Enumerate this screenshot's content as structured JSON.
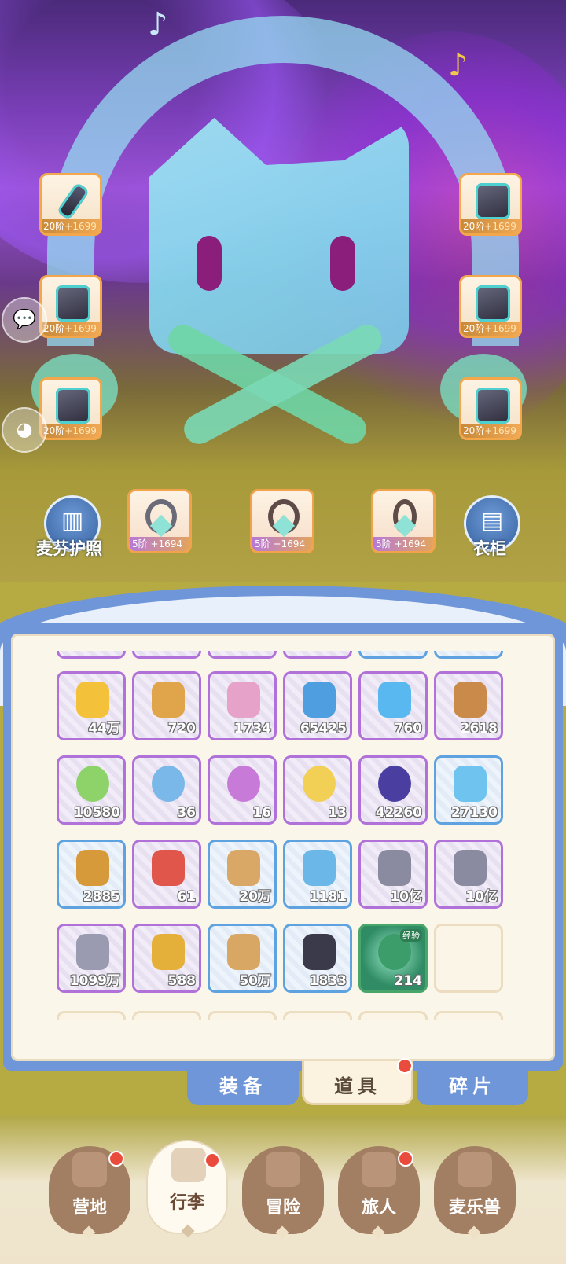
{
  "equipment": [
    {
      "name": "sword",
      "tier": "20阶",
      "plus": "+1699"
    },
    {
      "name": "helmet",
      "tier": "20阶",
      "plus": "+1699"
    },
    {
      "name": "armor",
      "tier": "20阶",
      "plus": "+1699"
    },
    {
      "name": "gloves",
      "tier": "20阶",
      "plus": "+1699"
    },
    {
      "name": "pants",
      "tier": "20阶",
      "plus": "+1699"
    },
    {
      "name": "boots",
      "tier": "20阶",
      "plus": "+1699"
    }
  ],
  "accessories": [
    {
      "name": "bracelet",
      "tier": "5阶",
      "plus": "+1694"
    },
    {
      "name": "necklace",
      "tier": "5阶",
      "plus": "+1694"
    },
    {
      "name": "pendant",
      "tier": "5阶",
      "plus": "+1694"
    }
  ],
  "passport_label": "麦芬护照",
  "wardrobe_label": "衣柜",
  "inventory": [
    {
      "count": "44万",
      "rarity": "purple",
      "icon": "gold-leaf-icon",
      "color": "#f3c23a"
    },
    {
      "count": "720",
      "rarity": "purple",
      "icon": "star-cookie-icon",
      "color": "#e0a44a"
    },
    {
      "count": "1734",
      "rarity": "purple",
      "icon": "paint-tube-icon",
      "color": "#e6a2c8"
    },
    {
      "count": "65425",
      "rarity": "purple",
      "icon": "ticket-icon",
      "color": "#4f9fe0"
    },
    {
      "count": "760",
      "rarity": "purple",
      "icon": "blue-crystal-icon",
      "color": "#5ab8f0"
    },
    {
      "count": "2618",
      "rarity": "purple",
      "icon": "book-icon",
      "color": "#c98a4a"
    },
    {
      "count": "10580",
      "rarity": "purple",
      "icon": "clover-coin-icon",
      "color": "#8ed26a"
    },
    {
      "count": "36",
      "rarity": "purple",
      "icon": "blue-flower-icon",
      "color": "#7ab8ea"
    },
    {
      "count": "16",
      "rarity": "purple",
      "icon": "purple-flower-icon",
      "color": "#c77ad8"
    },
    {
      "count": "13",
      "rarity": "purple",
      "icon": "yellow-flower-icon",
      "color": "#f2cf55"
    },
    {
      "count": "42260",
      "rarity": "purple",
      "icon": "egg-icon",
      "color": "#4a3fa0"
    },
    {
      "count": "27130",
      "rarity": "blue",
      "icon": "blue-gem-icon",
      "color": "#6fc3ef"
    },
    {
      "count": "2885",
      "rarity": "blue",
      "icon": "amber-shard-icon",
      "color": "#d79a3a"
    },
    {
      "count": "61",
      "rarity": "purple",
      "icon": "card-icon",
      "color": "#e0564a"
    },
    {
      "count": "20万",
      "rarity": "blue",
      "icon": "paw-bag-icon",
      "color": "#d9a766"
    },
    {
      "count": "1181",
      "rarity": "blue",
      "icon": "cat-mirror-icon",
      "color": "#6bb8e8"
    },
    {
      "count": "10亿",
      "rarity": "purple",
      "icon": "iron-ingot-icon",
      "color": "#8a8aa0"
    },
    {
      "count": "10亿",
      "rarity": "purple",
      "icon": "iron-ingot-icon",
      "color": "#8a8aa0"
    },
    {
      "count": "1099万",
      "rarity": "purple",
      "icon": "iron-ingot-icon",
      "color": "#9a9ab0"
    },
    {
      "count": "588",
      "rarity": "purple",
      "icon": "lock-icon",
      "color": "#e5b03a"
    },
    {
      "count": "50万",
      "rarity": "blue",
      "icon": "star-card-icon",
      "color": "#d8a763"
    },
    {
      "count": "1833",
      "rarity": "blue",
      "icon": "ore-icon",
      "color": "#3a3a4a"
    },
    {
      "count": "214",
      "rarity": "green",
      "icon": "exp-orb-icon",
      "color": "#3c9c6a",
      "badge": "经验"
    },
    {
      "count": "",
      "rarity": "empty",
      "icon": "",
      "color": ""
    }
  ],
  "tabs": [
    {
      "label": "装备",
      "active": false
    },
    {
      "label": "道具",
      "active": true
    },
    {
      "label": "碎片",
      "active": false
    }
  ],
  "nav": [
    {
      "label": "营地",
      "dot": true
    },
    {
      "label": "行李",
      "dot": true,
      "active": true
    },
    {
      "label": "冒险",
      "dot": false
    },
    {
      "label": "旅人",
      "dot": true
    },
    {
      "label": "麦乐兽",
      "dot": false
    }
  ]
}
